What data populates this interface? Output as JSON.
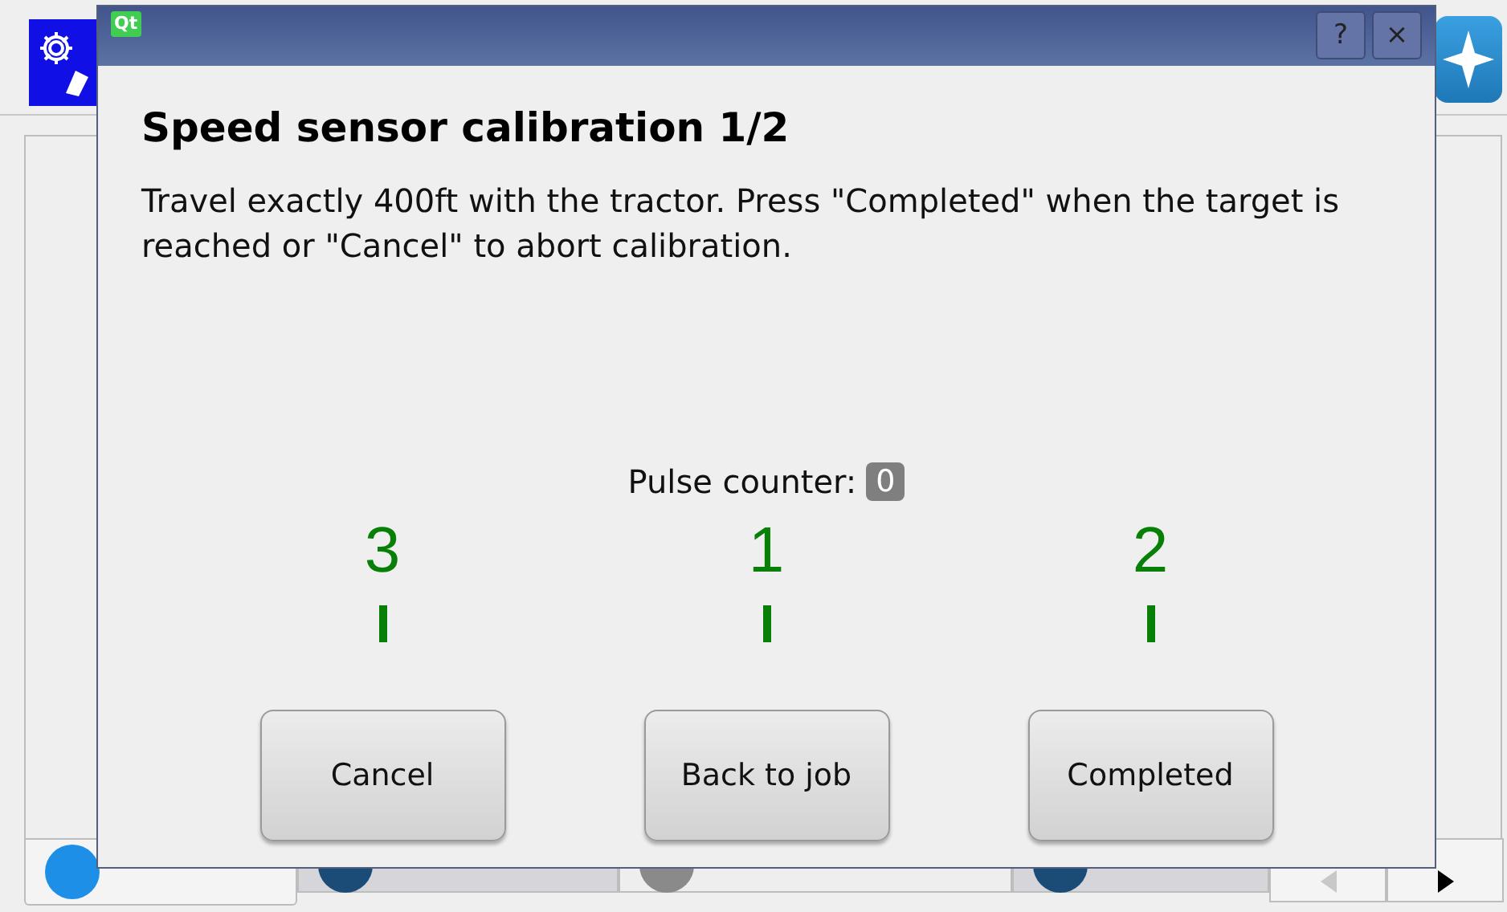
{
  "app": {
    "tabs": [
      {
        "selected": true,
        "disabled": false,
        "color": "#1e8fe6"
      },
      {
        "selected": false,
        "disabled": false,
        "color": "#1b4c78"
      },
      {
        "selected": false,
        "disabled": true,
        "color": "#8a8a8a"
      },
      {
        "selected": false,
        "disabled": false,
        "color": "#1b4c78"
      }
    ],
    "scroll_buttons": [
      {
        "kind": "left",
        "disabled": true
      },
      {
        "kind": "right",
        "disabled": false
      }
    ]
  },
  "dialog": {
    "logo": "Qt",
    "title_buttons": [
      "?",
      "×"
    ],
    "heading": "Speed sensor calibration 1/2",
    "message": "Travel exactly 400ft with the tractor. Press \"Completed\" when the target is reached or \"Cancel\" to abort calibration.",
    "pulse_label": "Pulse counter:",
    "pulse_value": "0",
    "markers": [
      "3",
      "1",
      "2"
    ],
    "buttons": [
      "Cancel",
      "Back to job",
      "Completed"
    ]
  }
}
